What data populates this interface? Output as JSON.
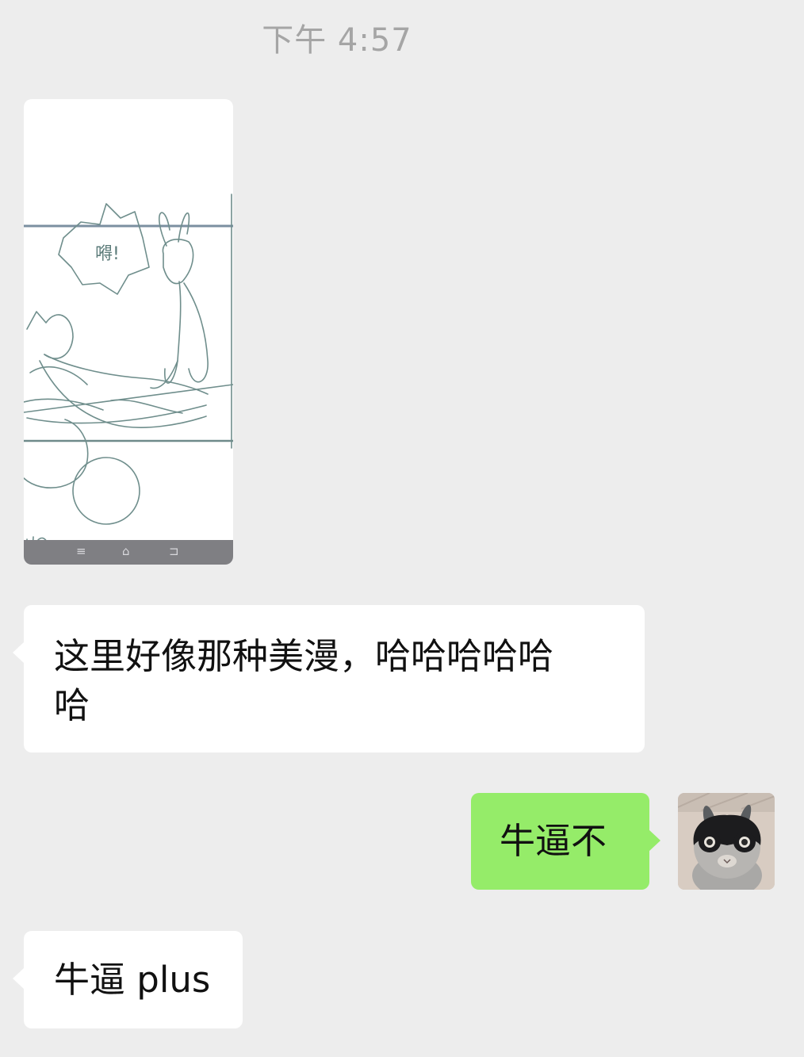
{
  "timestamp": "下午 4:57",
  "image_message": {
    "sketch_caption": "嘚!",
    "nav_icons": [
      "menu-icon",
      "home-icon",
      "back-icon"
    ]
  },
  "messages": [
    {
      "side": "left",
      "text": "这里好像那种美漫，哈哈哈哈哈\n哈"
    },
    {
      "side": "right",
      "text": "牛逼不"
    },
    {
      "side": "left",
      "text": "牛逼 plus"
    }
  ],
  "colors": {
    "background": "#ededed",
    "incoming_bubble": "#ffffff",
    "outgoing_bubble": "#95ec69",
    "timestamp_text": "#a5a5a5"
  }
}
